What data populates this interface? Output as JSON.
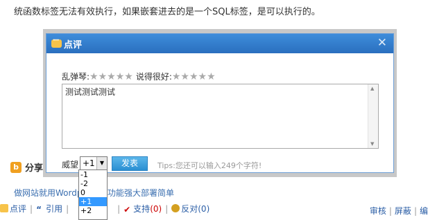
{
  "page": {
    "top_text": "统函数标签无法有效执行，如果嵌套进去的是一个SQL标签，是可以执行的。",
    "share_label": "分享到",
    "link_text": "做网站就用Wordpress，功能强大部署简单",
    "actions": {
      "comment": "点评",
      "quote": "引用",
      "support": "支持",
      "support_count": "(0)",
      "oppose": "反对",
      "oppose_count": "(0)"
    },
    "right_actions": {
      "review": "审核",
      "block": "屏蔽",
      "edit": "编"
    }
  },
  "dialog": {
    "title": "点评",
    "close_symbol": "✕",
    "rating1_label": "乱弹琴:",
    "rating1_stars": "★★★★★",
    "rating2_label": "说得很好:",
    "rating2_stars": "★★★★★",
    "comment_value": "测试测试测试",
    "mood_label": "威望",
    "select_value": "+1",
    "options": [
      "-1",
      "-2",
      "0",
      "+1",
      "+2"
    ],
    "selected_option": "+1",
    "send_label": "发表",
    "tips": "Tips:您还可以输入249个字符!"
  }
}
